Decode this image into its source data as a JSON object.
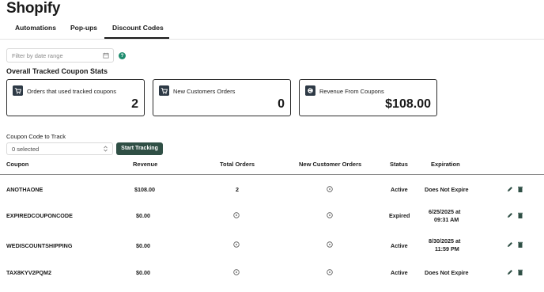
{
  "app": {
    "brand": "Shopify"
  },
  "tabs": [
    {
      "label": "Automations"
    },
    {
      "label": "Pop-ups"
    },
    {
      "label": "Discount Codes",
      "active": true
    }
  ],
  "filter": {
    "placeholder": "Filter by date range",
    "help": "?"
  },
  "stats": {
    "title": "Overall Tracked Coupon Stats",
    "cards": [
      {
        "label": "Orders that used tracked coupons",
        "value": "2",
        "icon": "cart-icon"
      },
      {
        "label": "New Customers Orders",
        "value": "0",
        "icon": "cart-icon"
      },
      {
        "label": "Revenue From Coupons",
        "value": "$108.00",
        "icon": "coupon-icon"
      }
    ]
  },
  "tracker": {
    "label": "Coupon Code to Track",
    "selected": "0 selected",
    "button": "Start Tracking"
  },
  "table": {
    "headers": [
      "Coupon",
      "Revenue",
      "Total Orders",
      "New Customer Orders",
      "Status",
      "Expiration"
    ],
    "rows": [
      {
        "coupon": "ANOTHAONE",
        "revenue": "$108.00",
        "total_orders": "2",
        "new_orders": "",
        "status": "Active",
        "exp1": "Does Not Expire",
        "exp2": ""
      },
      {
        "coupon": "EXPIREDCOUPONCODE",
        "revenue": "$0.00",
        "total_orders": "",
        "new_orders": "",
        "status": "Expired",
        "exp1": "6/25/2025 at",
        "exp2": "09:31 AM"
      },
      {
        "coupon": "WEDISCOUNTSHIPPING",
        "revenue": "$0.00",
        "total_orders": "",
        "new_orders": "",
        "status": "Active",
        "exp1": "8/30/2025 at",
        "exp2": "11:59 PM"
      },
      {
        "coupon": "TAX8KYV2PQM2",
        "revenue": "$0.00",
        "total_orders": "",
        "new_orders": "",
        "status": "Active",
        "exp1": "Does Not Expire",
        "exp2": ""
      }
    ]
  },
  "colors": {
    "accent": "#2f4f45",
    "help": "#1e8c6e",
    "card_icon": "#2e3a46"
  }
}
